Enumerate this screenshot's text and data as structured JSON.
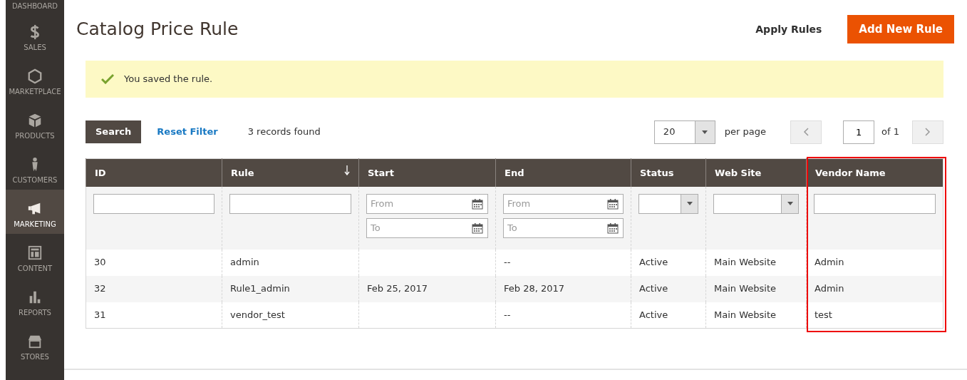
{
  "sidebar": {
    "items": [
      {
        "label": "DASHBOARD",
        "selected": false
      },
      {
        "label": "SALES",
        "selected": false
      },
      {
        "label": "MARKETPLACE",
        "selected": false
      },
      {
        "label": "PRODUCTS",
        "selected": false
      },
      {
        "label": "CUSTOMERS",
        "selected": false
      },
      {
        "label": "MARKETING",
        "selected": true
      },
      {
        "label": "CONTENT",
        "selected": false
      },
      {
        "label": "REPORTS",
        "selected": false
      },
      {
        "label": "STORES",
        "selected": false
      }
    ]
  },
  "header": {
    "title": "Catalog Price Rule",
    "actions": [
      {
        "label": "Apply Rules",
        "kind": "link"
      },
      {
        "label": "Add New Rule",
        "kind": "primary"
      }
    ]
  },
  "message": {
    "text": "You saved the rule."
  },
  "toolbar": {
    "search": "Search",
    "reset": "Reset Filter",
    "count": "3 records found",
    "page_size": "20",
    "per_page": "per page",
    "page": "1",
    "of": "of 1"
  },
  "table": {
    "columns": [
      {
        "label": "ID",
        "kind": "text",
        "sorted": false,
        "highlight": false
      },
      {
        "label": "Rule",
        "kind": "text",
        "sorted": true,
        "highlight": false
      },
      {
        "label": "Start",
        "kind": "daterange",
        "placeholders": [
          "From",
          "To"
        ],
        "sorted": false,
        "highlight": false
      },
      {
        "label": "End",
        "kind": "daterange",
        "placeholders": [
          "From",
          "To"
        ],
        "sorted": false,
        "highlight": false
      },
      {
        "label": "Status",
        "kind": "select",
        "sorted": false,
        "highlight": false
      },
      {
        "label": "Web Site",
        "kind": "select",
        "sorted": false,
        "highlight": false
      },
      {
        "label": "Vendor Name",
        "kind": "text",
        "sorted": false,
        "highlight": true
      }
    ],
    "rows": [
      [
        "30",
        "admin",
        "",
        "--",
        "Active",
        "Main Website",
        "Admin"
      ],
      [
        "32",
        "Rule1_admin",
        "Feb 25, 2017",
        "Feb 28, 2017",
        "Active",
        "Main Website",
        "Admin"
      ],
      [
        "31",
        "vendor_test",
        "",
        "--",
        "Active",
        "Main Website",
        "test"
      ]
    ]
  }
}
